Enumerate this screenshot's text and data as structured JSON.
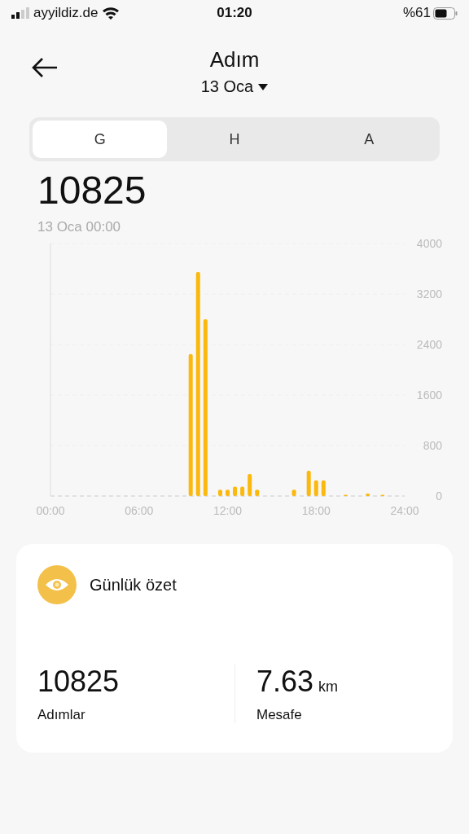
{
  "status_bar": {
    "carrier": "ayyildiz.de",
    "time": "01:20",
    "battery": "%61"
  },
  "header": {
    "title": "Adım",
    "date": "13 Oca"
  },
  "tabs": [
    {
      "label": "G",
      "selected": true
    },
    {
      "label": "H",
      "selected": false
    },
    {
      "label": "A",
      "selected": false
    }
  ],
  "total": "10825",
  "timestamp": "13 Oca 00:00",
  "chart_data": {
    "type": "bar",
    "x": [
      9.5,
      10,
      10.5,
      11.5,
      12,
      12.5,
      13,
      13.5,
      14,
      16.5,
      17.5,
      18,
      18.5,
      20,
      21.5,
      22.5
    ],
    "values": [
      2250,
      3550,
      2800,
      100,
      100,
      150,
      150,
      350,
      100,
      100,
      400,
      250,
      250,
      20,
      40,
      20
    ],
    "xlim": [
      0,
      24
    ],
    "ylim": [
      0,
      4000
    ],
    "xticks": [
      {
        "value": 0,
        "label": "00:00"
      },
      {
        "value": 6,
        "label": "06:00"
      },
      {
        "value": 12,
        "label": "12:00"
      },
      {
        "value": 18,
        "label": "18:00"
      },
      {
        "value": 24,
        "label": "24:00"
      }
    ],
    "yticks": [
      0,
      800,
      1600,
      2400,
      3200,
      4000
    ]
  },
  "summary": {
    "title": "Günlük özet",
    "stats": [
      {
        "value": "10825",
        "label": "Adımlar"
      },
      {
        "value": "7.63",
        "unit": "km",
        "label": "Mesafe"
      }
    ]
  }
}
